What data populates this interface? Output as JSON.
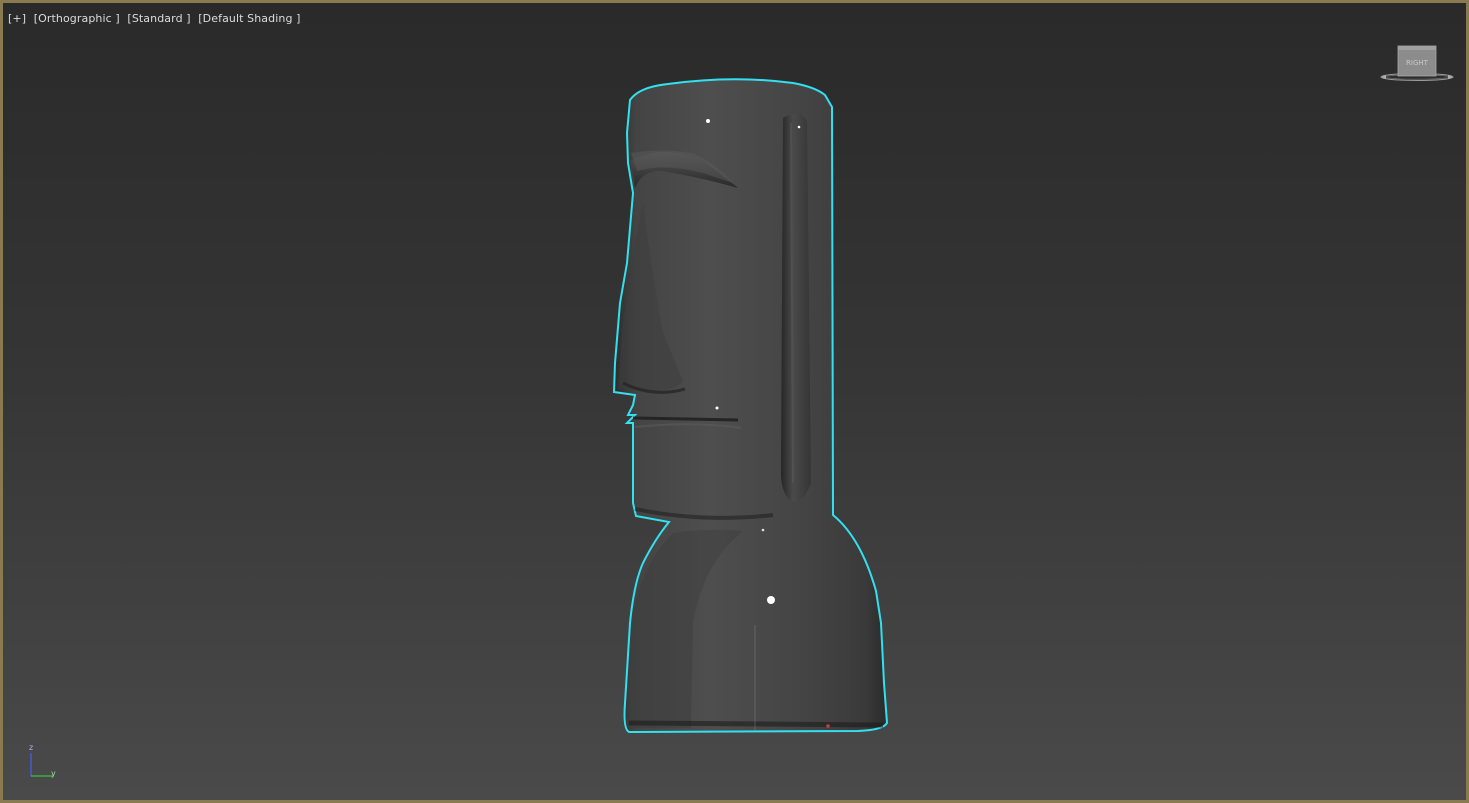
{
  "viewport": {
    "labels": {
      "menu": "[+]",
      "view": "[Orthographic ]",
      "visual_style": "[Standard ]",
      "shading": "[Default Shading ]"
    },
    "viewcube": {
      "face_label": "RIGHT"
    },
    "axis_gizmo": {
      "z_label": "z",
      "y_label": "y"
    },
    "selection_outline_color": "#33e0f0",
    "model": {
      "object": "stone head statue",
      "selected": true
    },
    "border_color": "#8a7a52"
  }
}
